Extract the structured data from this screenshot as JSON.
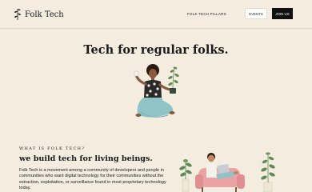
{
  "brand": {
    "name": "Folk Tech"
  },
  "nav": {
    "pillars_label": "FOLK TECH PILLARS",
    "events_label": "EVENTS",
    "join_label": "JOIN US"
  },
  "hero": {
    "title": "Tech for regular folks."
  },
  "about": {
    "eyebrow": "WHAT IS FOLK TECH?",
    "title": "we build tech for living beings.",
    "body": "Folk Tech is a movement among a community of developers and people in communities who want digital technology for their communities without the extraction, exploitation, or surveillance found in most proprietary technology today."
  },
  "colors": {
    "background": "#f3ecdf",
    "ink": "#1a1a1a",
    "join_button": "#111111",
    "chair": "#e9a3a4",
    "pants": "#8fc3c6",
    "plant": "#5e8a55"
  },
  "icons": {
    "logo": "leaf-sprig-icon"
  }
}
